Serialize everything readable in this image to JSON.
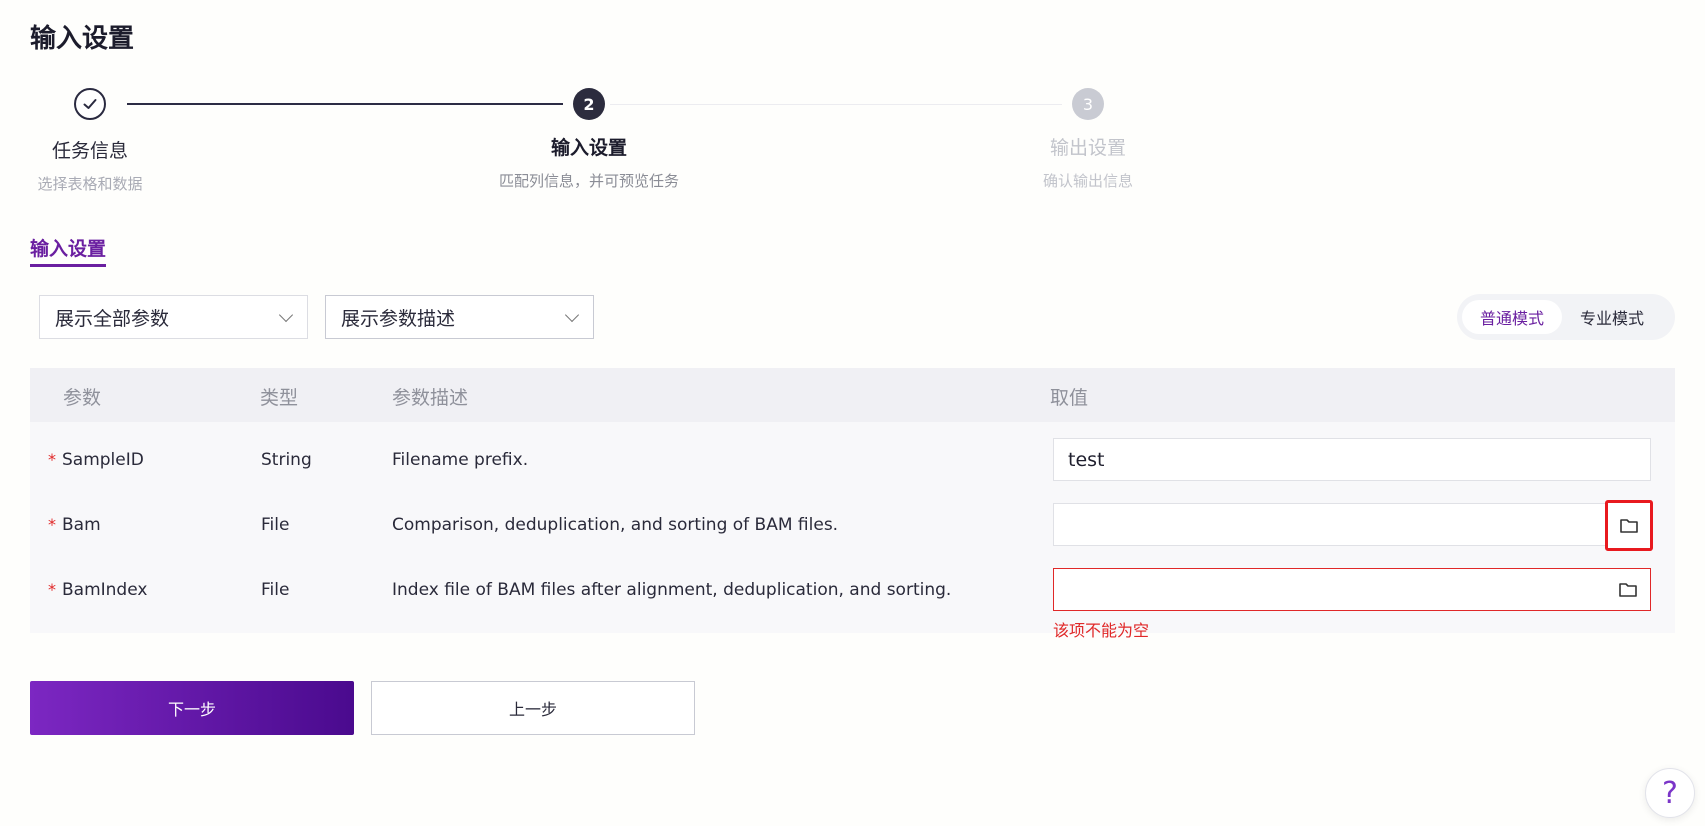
{
  "page": {
    "title": "输入设置"
  },
  "steps": [
    {
      "number": "1",
      "title": "任务信息",
      "subtitle": "选择表格和数据",
      "status": "done"
    },
    {
      "number": "2",
      "title": "输入设置",
      "subtitle": "匹配列信息，并可预览任务",
      "status": "active"
    },
    {
      "number": "3",
      "title": "输出设置",
      "subtitle": "确认输出信息",
      "status": "pending"
    }
  ],
  "section": {
    "title": "输入设置"
  },
  "filters": {
    "params_select": "展示全部参数",
    "desc_select": "展示参数描述"
  },
  "mode": {
    "normal": "普通模式",
    "pro": "专业模式",
    "active": "normal"
  },
  "table": {
    "headers": {
      "param": "参数",
      "type": "类型",
      "desc": "参数描述",
      "value": "取值"
    },
    "rows": [
      {
        "required": "*",
        "name": "SampleID",
        "type": "String",
        "desc": "Filename prefix.",
        "value": "test"
      },
      {
        "required": "*",
        "name": "Bam",
        "type": "File",
        "desc": "Comparison, deduplication, and sorting of BAM files.",
        "value": ""
      },
      {
        "required": "*",
        "name": "BamIndex",
        "type": "File",
        "desc": "Index file of BAM files after alignment, deduplication, and sorting.",
        "value": "",
        "error": "该项不能为空"
      }
    ]
  },
  "buttons": {
    "next": "下一步",
    "prev": "上一步"
  },
  "help": {
    "label": "?"
  },
  "colors": {
    "accent": "#6a1fa0",
    "error": "#e02828",
    "highlight": "#e8191f"
  },
  "icons": {
    "done_step": "check-icon",
    "file_picker": "folder-icon",
    "dropdown": "chevron-down-icon"
  }
}
